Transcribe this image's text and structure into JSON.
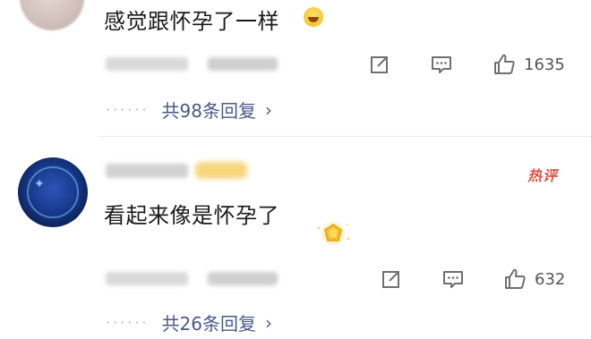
{
  "comments": [
    {
      "text": "感觉跟怀孕了一样",
      "emoji": "laughing-crying-emoji",
      "like_count": "1635",
      "replies_label": "共98条回复"
    },
    {
      "text": "看起来像是怀孕了",
      "tag": "热评",
      "like_count": "632",
      "replies_label": "共26条回复"
    }
  ],
  "icons": [
    "share-icon",
    "comment-icon",
    "like-icon",
    "chevron-right-icon",
    "gold-badge-icon"
  ],
  "colors": {
    "reply_link": "#4a5a86",
    "hot_tag": "#d95545",
    "divider": "#ececec"
  }
}
